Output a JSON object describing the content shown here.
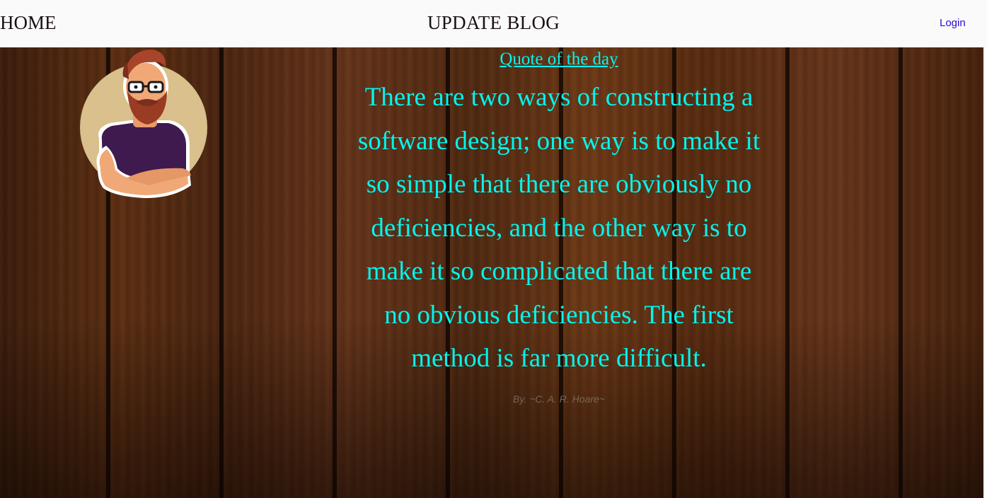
{
  "nav": {
    "home_label": "HOME",
    "title": "UPDATE BLOG",
    "login_label": "Login"
  },
  "quote": {
    "heading": "Quote of the day",
    "text": "There are two ways of constructing a software design; one way is to make it so simple that there are obviously no deficiencies, and the other way is to make it so complicated that there are no obvious deficiencies. The first method is far more difficult.",
    "author": "By. ~C. A. R. Hoare~"
  },
  "avatar": {
    "icon": "bearded-man-avatar-icon"
  },
  "colors": {
    "quote_text": "#00f5ee",
    "nav_background": "#fbfafa",
    "login_link": "#2a0ad0",
    "author_text": "#76665a",
    "background": "#5a2d12"
  }
}
